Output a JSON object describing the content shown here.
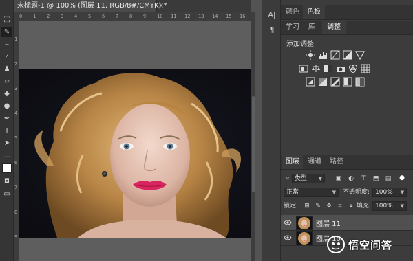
{
  "document": {
    "tab_title": "未标题-1 @ 100% (图层 11, RGB/8#/CMYK) *",
    "close_glyph": "×"
  },
  "rulers": {
    "top_ticks": [
      "0",
      "1",
      "2",
      "3",
      "4",
      "5",
      "6",
      "7",
      "8",
      "9",
      "10",
      "11",
      "12",
      "13",
      "14",
      "15",
      "16"
    ],
    "left_ticks": [
      "1",
      "2",
      "3",
      "4",
      "5",
      "6",
      "7",
      "8",
      "9"
    ]
  },
  "mini_panel": {
    "char_glyph": "A|",
    "para_glyph": "¶"
  },
  "top_panel": {
    "tabs": [
      "颜色",
      "色板"
    ],
    "active_tab": "色板"
  },
  "adjust_panel": {
    "tabs": [
      "学习",
      "库",
      "调整"
    ],
    "active_tab": "调整",
    "title": "添加调整",
    "icons_row1": [
      "brightness-contrast-icon",
      "levels-icon",
      "curves-icon",
      "exposure-icon",
      "triangle-icon"
    ],
    "icons_row2": [
      "vibrance-icon",
      "balance-icon",
      "black-white-icon",
      "camera-icon",
      "channel-mixer-icon",
      "color-lookup-icon"
    ],
    "icons_row3": [
      "invert-icon",
      "posterize-icon",
      "threshold-icon",
      "gradient-map-icon",
      "selective-color-icon"
    ]
  },
  "layers_panel": {
    "tabs": [
      "图层",
      "通道",
      "路径"
    ],
    "active_tab": "图层",
    "filter_label": "类型",
    "blend_mode": "正常",
    "opacity_label": "不透明度:",
    "opacity_value": "100%",
    "lock_label": "锁定:",
    "fill_label": "填充:",
    "fill_value": "100%",
    "layers": [
      {
        "name": "图层 11",
        "selected": true
      },
      {
        "name": "图层 10",
        "selected": false
      }
    ]
  },
  "watermark": {
    "text": "悟空问答"
  },
  "colors": {
    "accent_lips": "#d8245f",
    "hair": "#c99a5e",
    "background": "#535353"
  }
}
